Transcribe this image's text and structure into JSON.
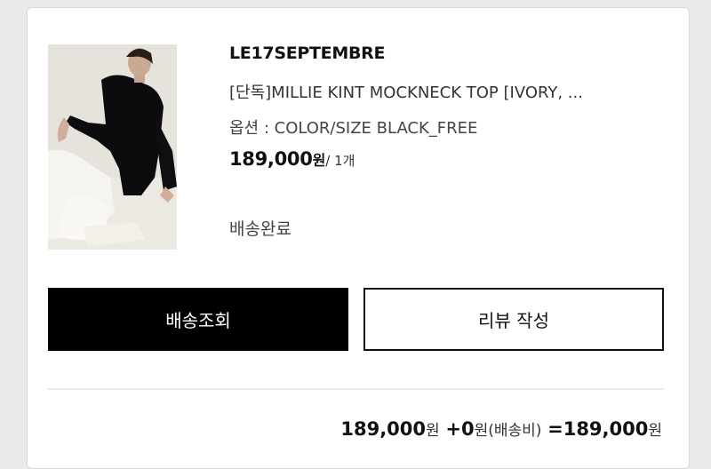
{
  "order_item": {
    "brand": "LE17SEPTEMBRE",
    "product_name": "[단독]MILLIE KINT MOCKNECK TOP [IVORY, ...",
    "option_text": "옵션 : COLOR/SIZE BLACK_FREE",
    "price": "189,000",
    "price_currency": "원",
    "quantity_text": "/ 1개",
    "status": "배송완료",
    "image_alt": "product-photo-model-black-mockneck"
  },
  "actions": {
    "track_label": "배송조회",
    "review_label": "리뷰 작성"
  },
  "summary": {
    "item_price": "189,000",
    "item_unit": "원",
    "plus": "+",
    "shipping": "0",
    "shipping_unit": "원",
    "shipping_label": "(배송비)",
    "equals": "=",
    "total": "189,000",
    "total_unit": "원"
  },
  "colors": {
    "primary_button_bg": "#000000",
    "primary_button_text": "#ffffff",
    "outline_button_border": "#111111",
    "background": "#e9e9e9",
    "card": "#ffffff"
  }
}
